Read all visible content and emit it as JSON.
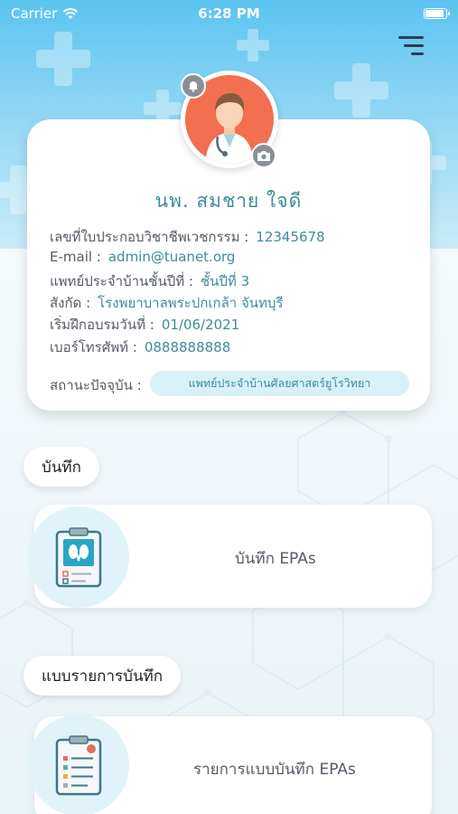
{
  "status_bar": {
    "carrier": "Carrier",
    "time": "6:28 PM",
    "icons": [
      "wifi-icon",
      "battery-icon"
    ]
  },
  "header": {
    "menu_icon": "filter-menu-icon"
  },
  "profile": {
    "avatar_icon": "doctor-avatar-icon",
    "bell_icon": "bell-icon",
    "camera_icon": "camera-icon",
    "name": "นพ. สมชาย ใจดี",
    "rows": [
      {
        "label": "เลขที่ใบประกอบวิชาชีพเวชกรรม :",
        "value": "12345678"
      },
      {
        "label": "E-mail :",
        "value": "admin@tuanet.org"
      },
      {
        "label": "แพทย์ประจำบ้านชั้นปีที่ :",
        "value": "ชั้นปีที่ 3"
      },
      {
        "label": "สังกัด :",
        "value": "โรงพยาบาลพระปกเกล้า จันทบุรี"
      },
      {
        "label": "เริ่มฝึกอบรมวันที่ :",
        "value": "01/06/2021"
      },
      {
        "label": "เบอร์โทรศัพท์ :",
        "value": "0888888888"
      }
    ],
    "status_label": "สถานะปัจจุบัน :",
    "status_value": "แพทย์ประจำบ้านศัลยศาสตร์ยูโรวิทยา"
  },
  "sections": [
    {
      "tag": "บันทึก",
      "item_label": "บันทึก EPAs",
      "icon": "clipboard-kidney-icon"
    },
    {
      "tag": "แบบรายการบันทึก",
      "item_label": "รายการแบบบันทึก EPAs",
      "icon": "clipboard-checklist-icon"
    }
  ],
  "colors": {
    "accent_teal": "#3d8c99",
    "hero_blue": "#5cc3f0",
    "avatar_orange": "#f26f4f",
    "pill_bg": "#d8f1f8"
  }
}
